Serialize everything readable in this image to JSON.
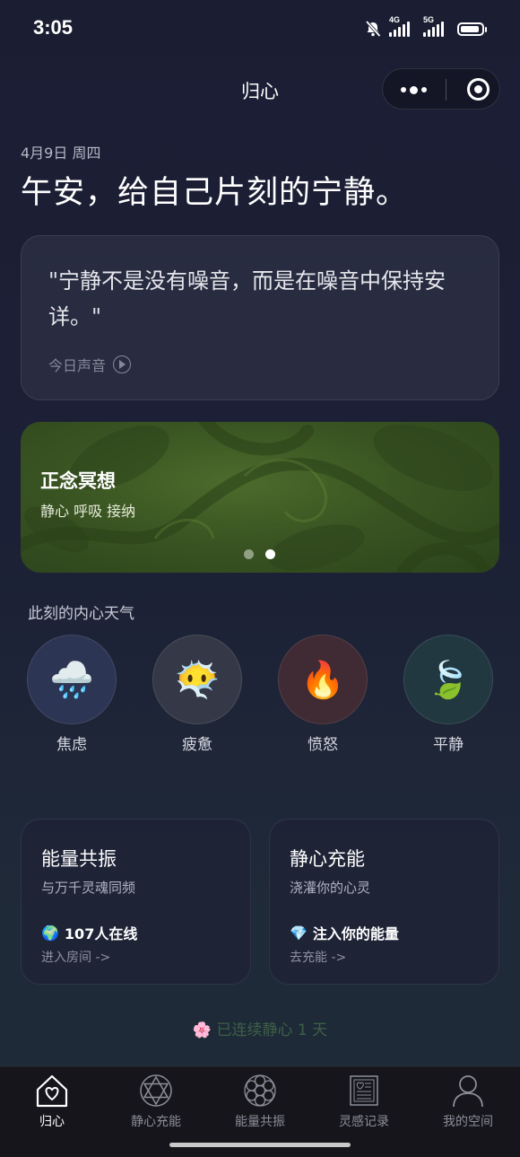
{
  "status_bar": {
    "time": "3:05",
    "network_1": "4G",
    "network_2": "5G",
    "icons": [
      "mute-bell-icon",
      "signal-icon",
      "signal-icon",
      "battery-icon"
    ]
  },
  "nav": {
    "title": "归心",
    "capsule_icons": [
      "more-dots-icon",
      "target-icon"
    ]
  },
  "header": {
    "date": "4月9日 周四",
    "greeting": "午安，给自己片刻的宁静。"
  },
  "quote_card": {
    "text": "\"宁静不是没有噪音，而是在噪音中保持安详。\"",
    "sound_label": "今日声音",
    "sound_icon": "play-circle-icon"
  },
  "banner": {
    "title": "正念冥想",
    "subtitle": "静心 呼吸 接纳",
    "page_count": 2,
    "active_page": 2
  },
  "weather": {
    "title": "此刻的内心天气",
    "moods": [
      {
        "label": "焦虑",
        "emoji": "🌧️",
        "icon": "rain-cloud-icon",
        "bg": "#2c3553"
      },
      {
        "label": "疲惫",
        "emoji": "😶‍🌫️",
        "icon": "fatigue-face-icon",
        "bg": "#353947"
      },
      {
        "label": "愤怒",
        "emoji": "🔥",
        "icon": "fire-icon",
        "bg": "#402a33"
      },
      {
        "label": "平静",
        "emoji": "🍃",
        "icon": "leaf-icon",
        "bg": "#223841"
      }
    ]
  },
  "cards": {
    "energy": {
      "title": "能量共振",
      "subtitle": "与万千灵魂同频",
      "stat_emoji": "🌍",
      "stat": "107人在线",
      "link": "进入房间 ->"
    },
    "recharge": {
      "title": "静心充能",
      "subtitle": "浇灌你的心灵",
      "stat_emoji": "💎",
      "stat": "注入你的能量",
      "link": "去充能 ->"
    }
  },
  "streak": {
    "emoji": "🌸",
    "text": "已连续静心 1 天"
  },
  "tabbar": {
    "tabs": [
      {
        "label": "归心",
        "icon": "home-heart-icon",
        "active": true
      },
      {
        "label": "静心充能",
        "icon": "star-of-david-icon",
        "active": false
      },
      {
        "label": "能量共振",
        "icon": "flower-of-life-icon",
        "active": false
      },
      {
        "label": "灵感记录",
        "icon": "journal-icon",
        "active": false
      },
      {
        "label": "我的空间",
        "icon": "user-icon",
        "active": false
      }
    ]
  },
  "colors": {
    "background": "#1c1f35",
    "card": "#262a40",
    "banner_green": "#3f5a25",
    "streak_text": "#3e6047"
  }
}
